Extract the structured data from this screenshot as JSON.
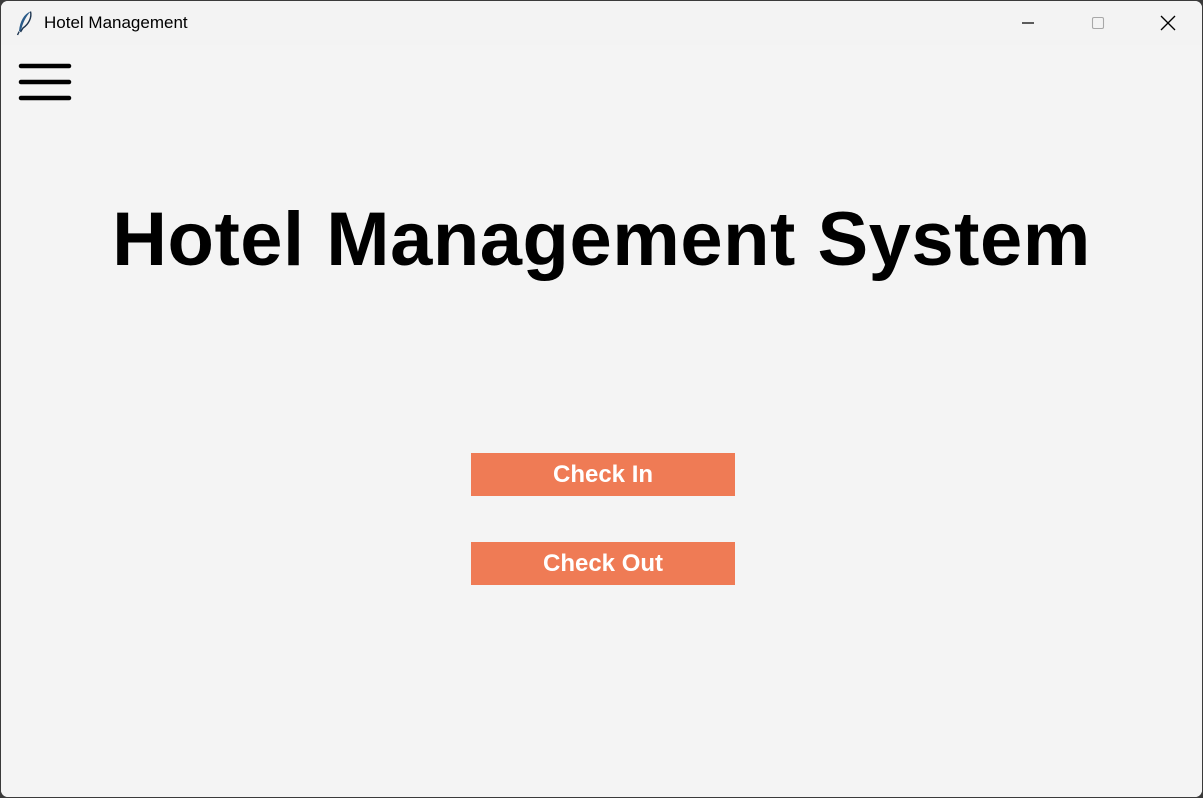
{
  "window": {
    "title": "Hotel Management",
    "icon": "feather-icon",
    "controls": [
      "minimize-icon",
      "maximize-icon",
      "close-icon"
    ]
  },
  "menu": {
    "icon": "hamburger-menu-icon"
  },
  "heading": {
    "text": "Hotel Management System"
  },
  "actions": {
    "check_in_label": "Check In",
    "check_out_label": "Check Out",
    "button_color": "#ef7b55",
    "button_text_color": "#ffffff"
  },
  "colors": {
    "background": "#f4f4f4",
    "text": "#000000"
  }
}
